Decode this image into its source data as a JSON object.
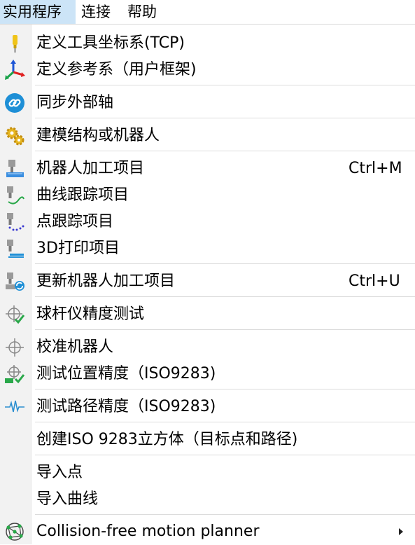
{
  "menubar": {
    "items": [
      "实用程序",
      "连接",
      "帮助"
    ]
  },
  "menu": {
    "items": [
      {
        "label": "定义工具坐标系(TCP)",
        "shortcut": "",
        "icon": "tool-tcp-icon"
      },
      {
        "label": "定义参考系（用户框架)",
        "shortcut": "",
        "icon": "reference-frame-icon"
      },
      {
        "label": "同步外部轴",
        "shortcut": "",
        "icon": "link-icon"
      },
      {
        "label": "建模结构或机器人",
        "shortcut": "",
        "icon": "gears-icon"
      },
      {
        "label": "机器人加工项目",
        "shortcut": "Ctrl+M",
        "icon": "machining-icon"
      },
      {
        "label": "曲线跟踪项目",
        "shortcut": "",
        "icon": "curve-follow-icon"
      },
      {
        "label": "点跟踪项目",
        "shortcut": "",
        "icon": "point-follow-icon"
      },
      {
        "label": "3D打印项目",
        "shortcut": "",
        "icon": "print-3d-icon"
      },
      {
        "label": "更新机器人加工项目",
        "shortcut": "Ctrl+U",
        "icon": "update-machining-icon"
      },
      {
        "label": "球杆仪精度测试",
        "shortcut": "",
        "icon": "ballbar-test-icon"
      },
      {
        "label": "校准机器人",
        "shortcut": "",
        "icon": "calibrate-icon"
      },
      {
        "label": "测试位置精度（ISO9283)",
        "shortcut": "",
        "icon": "iso-position-icon"
      },
      {
        "label": "测试路径精度（ISO9283)",
        "shortcut": "",
        "icon": "path-accuracy-icon"
      },
      {
        "label": "创建ISO 9283立方体（目标点和路径)",
        "shortcut": "",
        "icon": ""
      },
      {
        "label": "导入点",
        "shortcut": "",
        "icon": ""
      },
      {
        "label": "导入曲线",
        "shortcut": "",
        "icon": ""
      },
      {
        "label": "Collision-free motion planner",
        "shortcut": "",
        "icon": "motion-planner-icon",
        "submenu": true
      }
    ]
  },
  "colors": {
    "highlight": "#cce4f7",
    "gutter": "#f2f2f2",
    "separator": "#dcdcdc"
  }
}
